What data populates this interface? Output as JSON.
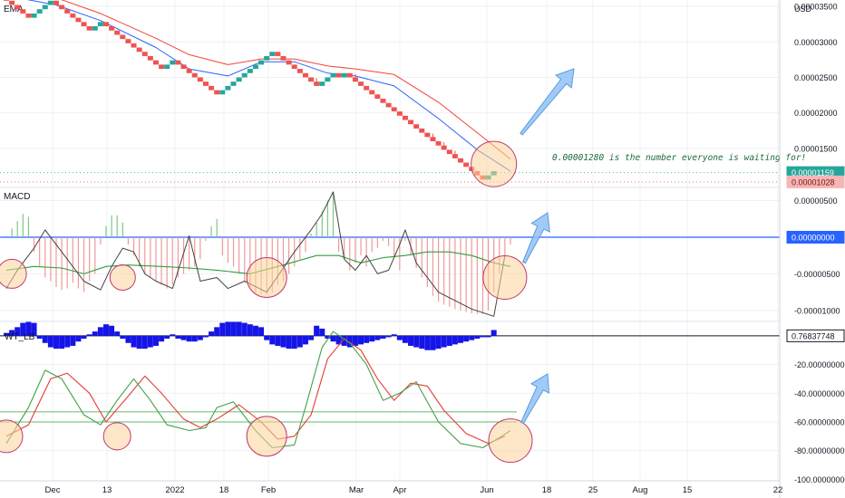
{
  "chart_data": [
    {
      "type": "renko",
      "panel": "price",
      "label": "EMA",
      "currency": "USD",
      "y_ticks": [
        "0.00003500",
        "0.00003000",
        "0.00002500",
        "0.00002000",
        "0.00001500"
      ],
      "ylim": [
        9.5e-06,
        3.59e-05
      ],
      "box_size": 6e-07,
      "bricks": [
        {
          "v": 3.58e-05,
          "d": "down"
        },
        {
          "v": 3.52e-05,
          "d": "down"
        },
        {
          "v": 3.46e-05,
          "d": "down"
        },
        {
          "v": 3.4e-05,
          "d": "down"
        },
        {
          "v": 3.34e-05,
          "d": "down"
        },
        {
          "v": 3.4e-05,
          "d": "up"
        },
        {
          "v": 3.46e-05,
          "d": "up"
        },
        {
          "v": 3.52e-05,
          "d": "up"
        },
        {
          "v": 3.58e-05,
          "d": "up"
        },
        {
          "v": 3.52e-05,
          "d": "down"
        },
        {
          "v": 3.46e-05,
          "d": "down"
        },
        {
          "v": 3.4e-05,
          "d": "down"
        },
        {
          "v": 3.34e-05,
          "d": "down"
        },
        {
          "v": 3.28e-05,
          "d": "down"
        },
        {
          "v": 3.22e-05,
          "d": "down"
        },
        {
          "v": 3.16e-05,
          "d": "down"
        },
        {
          "v": 3.22e-05,
          "d": "up"
        },
        {
          "v": 3.28e-05,
          "d": "up"
        },
        {
          "v": 3.22e-05,
          "d": "down"
        },
        {
          "v": 3.16e-05,
          "d": "down"
        },
        {
          "v": 3.1e-05,
          "d": "down"
        },
        {
          "v": 3.04e-05,
          "d": "down"
        },
        {
          "v": 2.98e-05,
          "d": "down"
        },
        {
          "v": 2.92e-05,
          "d": "down"
        },
        {
          "v": 2.86e-05,
          "d": "down"
        },
        {
          "v": 2.8e-05,
          "d": "down"
        },
        {
          "v": 2.74e-05,
          "d": "down"
        },
        {
          "v": 2.68e-05,
          "d": "down"
        },
        {
          "v": 2.62e-05,
          "d": "down"
        },
        {
          "v": 2.68e-05,
          "d": "up"
        },
        {
          "v": 2.74e-05,
          "d": "up"
        },
        {
          "v": 2.68e-05,
          "d": "down"
        },
        {
          "v": 2.62e-05,
          "d": "down"
        },
        {
          "v": 2.56e-05,
          "d": "down"
        },
        {
          "v": 2.5e-05,
          "d": "down"
        },
        {
          "v": 2.44e-05,
          "d": "down"
        },
        {
          "v": 2.38e-05,
          "d": "down"
        },
        {
          "v": 2.32e-05,
          "d": "down"
        },
        {
          "v": 2.26e-05,
          "d": "down"
        },
        {
          "v": 2.32e-05,
          "d": "up"
        },
        {
          "v": 2.38e-05,
          "d": "up"
        },
        {
          "v": 2.44e-05,
          "d": "up"
        },
        {
          "v": 2.5e-05,
          "d": "up"
        },
        {
          "v": 2.56e-05,
          "d": "up"
        },
        {
          "v": 2.62e-05,
          "d": "up"
        },
        {
          "v": 2.68e-05,
          "d": "up"
        },
        {
          "v": 2.74e-05,
          "d": "up"
        },
        {
          "v": 2.8e-05,
          "d": "up"
        },
        {
          "v": 2.86e-05,
          "d": "up"
        },
        {
          "v": 2.8e-05,
          "d": "down"
        },
        {
          "v": 2.74e-05,
          "d": "down"
        },
        {
          "v": 2.68e-05,
          "d": "down"
        },
        {
          "v": 2.62e-05,
          "d": "down"
        },
        {
          "v": 2.56e-05,
          "d": "down"
        },
        {
          "v": 2.5e-05,
          "d": "down"
        },
        {
          "v": 2.44e-05,
          "d": "down"
        },
        {
          "v": 2.38e-05,
          "d": "down"
        },
        {
          "v": 2.44e-05,
          "d": "up"
        },
        {
          "v": 2.5e-05,
          "d": "up"
        },
        {
          "v": 2.56e-05,
          "d": "up"
        },
        {
          "v": 2.5e-05,
          "d": "down"
        },
        {
          "v": 2.56e-05,
          "d": "up"
        },
        {
          "v": 2.5e-05,
          "d": "down"
        },
        {
          "v": 2.44e-05,
          "d": "down"
        },
        {
          "v": 2.38e-05,
          "d": "down"
        },
        {
          "v": 2.32e-05,
          "d": "down"
        },
        {
          "v": 2.26e-05,
          "d": "down"
        },
        {
          "v": 2.2e-05,
          "d": "down"
        },
        {
          "v": 2.14e-05,
          "d": "down"
        },
        {
          "v": 2.08e-05,
          "d": "down"
        },
        {
          "v": 2.02e-05,
          "d": "down"
        },
        {
          "v": 1.96e-05,
          "d": "down"
        },
        {
          "v": 1.9e-05,
          "d": "down"
        },
        {
          "v": 1.84e-05,
          "d": "down"
        },
        {
          "v": 1.78e-05,
          "d": "down"
        },
        {
          "v": 1.72e-05,
          "d": "down"
        },
        {
          "v": 1.66e-05,
          "d": "down"
        },
        {
          "v": 1.6e-05,
          "d": "down"
        },
        {
          "v": 1.54e-05,
          "d": "down"
        },
        {
          "v": 1.48e-05,
          "d": "down"
        },
        {
          "v": 1.42e-05,
          "d": "down"
        },
        {
          "v": 1.36e-05,
          "d": "down"
        },
        {
          "v": 1.3e-05,
          "d": "down"
        },
        {
          "v": 1.24e-05,
          "d": "down"
        },
        {
          "v": 1.18e-05,
          "d": "down"
        },
        {
          "v": 1.12e-05,
          "d": "down"
        },
        {
          "v": 1.06e-05,
          "d": "down"
        },
        {
          "v": 1.12e-05,
          "d": "up"
        },
        {
          "v": 1.18e-05,
          "d": "up"
        }
      ],
      "ema_fast": [
        [
          0,
          3.65e-05
        ],
        [
          9,
          3.52e-05
        ],
        [
          17,
          3.3e-05
        ],
        [
          27,
          2.92e-05
        ],
        [
          33,
          2.62e-05
        ],
        [
          40,
          2.52e-05
        ],
        [
          46,
          2.72e-05
        ],
        [
          52,
          2.72e-05
        ],
        [
          58,
          2.56e-05
        ],
        [
          63,
          2.52e-05
        ],
        [
          70,
          2.38e-05
        ],
        [
          78,
          1.92e-05
        ],
        [
          85,
          1.48e-05
        ],
        [
          91,
          1.18e-05
        ]
      ],
      "ema_slow": [
        [
          0,
          3.72e-05
        ],
        [
          9,
          3.62e-05
        ],
        [
          17,
          3.4e-05
        ],
        [
          27,
          3.05e-05
        ],
        [
          33,
          2.82e-05
        ],
        [
          40,
          2.68e-05
        ],
        [
          46,
          2.76e-05
        ],
        [
          52,
          2.76e-05
        ],
        [
          58,
          2.66e-05
        ],
        [
          63,
          2.62e-05
        ],
        [
          70,
          2.54e-05
        ],
        [
          78,
          2.15e-05
        ],
        [
          85,
          1.72e-05
        ],
        [
          91,
          1.35e-05
        ]
      ],
      "price_labels": [
        "0.00001159",
        "0.00001028"
      ],
      "price_label_colors": [
        "#26a69a",
        "#ef5350"
      ],
      "price_label_values": [
        1.159e-05,
        1.028e-05
      ],
      "annotation": "0.00001280 is the number everyone is waiting for!"
    },
    {
      "type": "histogram_line",
      "panel": "macd",
      "label": "MACD",
      "y_ticks": [
        "0.00000500",
        "-0.00000500",
        "-0.00001000"
      ],
      "ylim": [
        -1.15e-05,
        6.8e-06
      ],
      "zero_label": "0.00000000",
      "histogram": [
        2e-07,
        1.2e-06,
        2.2e-06,
        3.2e-06,
        2.8e-06,
        -2e-06,
        -4e-06,
        -5.5e-06,
        -6e-06,
        -6.8e-06,
        -7.2e-06,
        -7e-06,
        -6.2e-06,
        -7e-06,
        -7.5e-06,
        -6e-06,
        -5e-06,
        -1e-06,
        1.5e-06,
        3e-06,
        3e-06,
        2e-06,
        -1e-06,
        -2.5e-06,
        -4e-06,
        -5e-06,
        -5.5e-06,
        -6e-06,
        -6.5e-06,
        -7e-06,
        -6.5e-06,
        -5.5e-06,
        -5e-06,
        -4.5e-06,
        -4e-06,
        -3e-06,
        -5e-07,
        1.5e-06,
        2.5e-06,
        -2.5e-06,
        -3.5e-06,
        -4e-06,
        -5e-06,
        -6e-06,
        -6.8e-06,
        -7.5e-06,
        -7.8e-06,
        -7.8e-06,
        -7.5e-06,
        -6.5e-06,
        -6e-06,
        -5e-06,
        -4e-06,
        -3e-06,
        -2e-06,
        5e-07,
        2e-06,
        3.5e-06,
        5e-06,
        6.2e-06,
        -2e-06,
        -3e-06,
        -4.5e-06,
        -3.5e-06,
        -2.5e-06,
        -4e-06,
        -2e-06,
        -1.5e-06,
        -5e-07,
        -1.2e-06,
        -2.8e-06,
        -4.5e-06,
        -5e-07,
        -2.5e-06,
        -4.2e-06,
        -5.5e-06,
        -6.8e-06,
        -8e-06,
        -8.8e-06,
        -9.2e-06,
        -9.5e-06,
        -9.8e-06,
        -1e-05,
        -1.02e-05,
        -1.04e-05,
        -1.05e-05,
        -1.05e-05,
        -1e-05,
        -7.5e-06,
        -5e-06,
        -2.5e-06,
        -1e-06
      ],
      "macd_line": [
        [
          0,
          -7e-06
        ],
        [
          2,
          -4.5e-06
        ],
        [
          5,
          -1.5e-06
        ],
        [
          7,
          1e-06
        ],
        [
          11,
          -3e-06
        ],
        [
          14,
          -6e-06
        ],
        [
          17,
          -7.2e-06
        ],
        [
          19,
          -4e-06
        ],
        [
          21,
          -1.5e-06
        ],
        [
          23,
          -2e-06
        ],
        [
          25,
          -5e-06
        ],
        [
          27,
          -6e-06
        ],
        [
          30,
          -7e-06
        ],
        [
          33,
          2e-07
        ],
        [
          35,
          -6e-06
        ],
        [
          38,
          -5.5e-06
        ],
        [
          40,
          -7e-06
        ],
        [
          43,
          -6e-06
        ],
        [
          47,
          -7.5e-06
        ],
        [
          52,
          -2e-06
        ],
        [
          55,
          1e-06
        ],
        [
          57,
          3.2e-06
        ],
        [
          59,
          6.2e-06
        ],
        [
          61,
          -3e-06
        ],
        [
          63,
          -4.5e-06
        ],
        [
          65,
          -2.5e-06
        ],
        [
          67,
          -5e-06
        ],
        [
          69,
          -4.5e-06
        ],
        [
          71,
          -1e-06
        ],
        [
          72,
          1e-06
        ],
        [
          74,
          -3.5e-06
        ],
        [
          78,
          -7.5e-06
        ],
        [
          84,
          -9.8e-06
        ],
        [
          88,
          -1.08e-05
        ],
        [
          90,
          -2.5e-06
        ]
      ],
      "signal_line": [
        [
          0,
          -4.5e-06
        ],
        [
          5,
          -4e-06
        ],
        [
          10,
          -4.2e-06
        ],
        [
          14,
          -5e-06
        ],
        [
          18,
          -4e-06
        ],
        [
          22,
          -3.8e-06
        ],
        [
          28,
          -4e-06
        ],
        [
          33,
          -4.2e-06
        ],
        [
          38,
          -4.5e-06
        ],
        [
          44,
          -5e-06
        ],
        [
          50,
          -3.8e-06
        ],
        [
          56,
          -2.5e-06
        ],
        [
          60,
          -2.5e-06
        ],
        [
          64,
          -3.5e-06
        ],
        [
          68,
          -2.8e-06
        ],
        [
          72,
          -2.5e-06
        ],
        [
          76,
          -2e-06
        ],
        [
          80,
          -2e-06
        ],
        [
          84,
          -2.5e-06
        ],
        [
          88,
          -3.5e-06
        ],
        [
          91,
          -4e-06
        ]
      ]
    },
    {
      "type": "histogram_line",
      "panel": "oscillator",
      "label": "WT_LB",
      "y_ticks": [
        "-20.00000000",
        "-40.00000000",
        "-60.00000000",
        "-80.00000000",
        "-100.00000000"
      ],
      "ylim": [
        -101,
        10
      ],
      "histogram_label": "0.76837748",
      "histogram": [
        2,
        4,
        6,
        9,
        10,
        9,
        -2,
        -5,
        -8,
        -9,
        -9,
        -8,
        -7,
        -4,
        -2,
        1,
        3,
        6,
        8,
        7,
        3,
        -2,
        -5,
        -8,
        -9,
        -9,
        -8,
        -7,
        -4,
        -2,
        1,
        -2,
        -3,
        -4,
        -4,
        -3,
        -1,
        3,
        6,
        9,
        10,
        10,
        10,
        9,
        8,
        7,
        6,
        -3,
        -6,
        -7,
        -8,
        -9,
        -9,
        -8,
        -6,
        -3,
        7,
        5,
        -2,
        -4,
        -6,
        -7,
        -8,
        -7,
        -6,
        -5,
        -4,
        -3,
        -2,
        -1,
        1,
        -3,
        -5,
        -7,
        -8,
        -9,
        -10,
        -10,
        -9,
        -8,
        -7,
        -6,
        -5,
        -4,
        -3,
        -2,
        -1,
        -1,
        4
      ],
      "wt1": [
        [
          0,
          -75
        ],
        [
          4,
          -50
        ],
        [
          7,
          -24
        ],
        [
          10,
          -30
        ],
        [
          14,
          -55
        ],
        [
          17,
          -62
        ],
        [
          20,
          -45
        ],
        [
          23,
          -30
        ],
        [
          26,
          -45
        ],
        [
          29,
          -62
        ],
        [
          33,
          -66
        ],
        [
          36,
          -64
        ],
        [
          38,
          -50
        ],
        [
          41,
          -46
        ],
        [
          45,
          -66
        ],
        [
          48,
          -78
        ],
        [
          52,
          -76
        ],
        [
          54,
          -50
        ],
        [
          57,
          -8
        ],
        [
          59,
          3
        ],
        [
          62,
          -5
        ],
        [
          65,
          -20
        ],
        [
          68,
          -45
        ],
        [
          71,
          -40
        ],
        [
          74,
          -32
        ],
        [
          78,
          -60
        ],
        [
          82,
          -75
        ],
        [
          86,
          -78
        ],
        [
          89,
          -71
        ],
        [
          91,
          -66
        ]
      ],
      "wt2": [
        [
          0,
          -70
        ],
        [
          4,
          -62
        ],
        [
          8,
          -30
        ],
        [
          11,
          -26
        ],
        [
          15,
          -40
        ],
        [
          18,
          -60
        ],
        [
          22,
          -42
        ],
        [
          25,
          -28
        ],
        [
          28,
          -40
        ],
        [
          32,
          -58
        ],
        [
          35,
          -64
        ],
        [
          38,
          -58
        ],
        [
          42,
          -48
        ],
        [
          46,
          -60
        ],
        [
          49,
          -72
        ],
        [
          52,
          -70
        ],
        [
          55,
          -55
        ],
        [
          58,
          -16
        ],
        [
          61,
          -2
        ],
        [
          64,
          -10
        ],
        [
          67,
          -30
        ],
        [
          70,
          -45
        ],
        [
          73,
          -33
        ],
        [
          76,
          -35
        ],
        [
          79,
          -52
        ],
        [
          83,
          -68
        ],
        [
          87,
          -75
        ],
        [
          90,
          -70
        ]
      ],
      "ref_levels": [
        -53,
        -60
      ]
    }
  ],
  "x_axis": {
    "labels": [
      "Dec",
      "13",
      "2022",
      "18",
      "Feb",
      "Mar",
      "Apr",
      "Jun",
      "18",
      "25",
      "Aug",
      "15",
      "22"
    ]
  }
}
